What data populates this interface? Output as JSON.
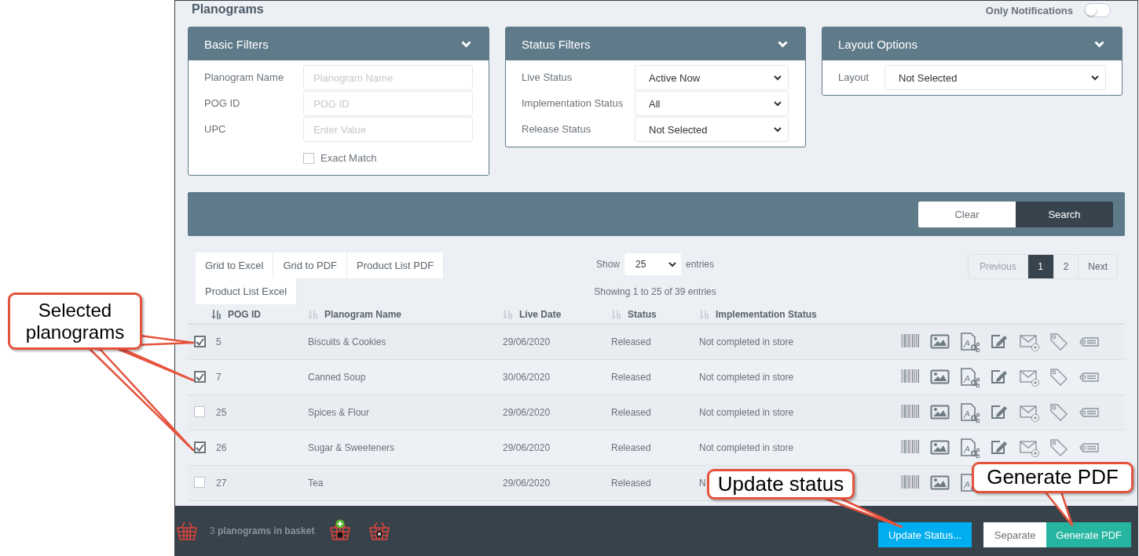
{
  "page": {
    "title": "Planograms",
    "only_notifications": {
      "label": "Only Notifications",
      "on": false
    }
  },
  "filter_panels": [
    {
      "title": "Basic Filters",
      "fields": [
        {
          "kind": "text",
          "label": "Planogram Name",
          "placeholder": "Planogram Name"
        },
        {
          "kind": "text",
          "label": "POG ID",
          "placeholder": "POG ID"
        },
        {
          "kind": "text",
          "label": "UPC",
          "placeholder": "Enter Value"
        }
      ],
      "exact_match": {
        "label": "Exact Match",
        "checked": false
      }
    },
    {
      "title": "Status Filters",
      "fields": [
        {
          "kind": "select",
          "label": "Live Status",
          "value": "Active Now"
        },
        {
          "kind": "select",
          "label": "Implementation Status",
          "value": "All"
        },
        {
          "kind": "select",
          "label": "Release Status",
          "value": "Not Selected"
        }
      ]
    },
    {
      "title": "Layout Options",
      "fields": [
        {
          "kind": "select",
          "label": "Layout",
          "value": "Not Selected"
        }
      ]
    }
  ],
  "search_bar": {
    "buttons": [
      {
        "kind": "secondary",
        "label": "Clear"
      },
      {
        "kind": "primary",
        "label": "Search"
      }
    ]
  },
  "exports": [
    "Grid to Excel",
    "Grid to PDF",
    "Product List PDF",
    "Product List Excel"
  ],
  "page_size": {
    "show_label": "Show",
    "value": "25",
    "entries_label": "entries"
  },
  "info": "Showing 1 to 25 of 39 entries",
  "pagination": [
    {
      "label": "Previous",
      "selected": false,
      "disabled": true
    },
    {
      "label": "1",
      "selected": true,
      "disabled": false
    },
    {
      "label": "2",
      "selected": false,
      "disabled": false
    },
    {
      "label": "Next",
      "selected": false,
      "disabled": false
    }
  ],
  "table": {
    "columns": [
      {
        "label": "POG ID",
        "sorted": true
      },
      {
        "label": "Planogram Name",
        "sorted": false
      },
      {
        "label": "Live Date",
        "sorted": false
      },
      {
        "label": "Status",
        "sorted": false
      },
      {
        "label": "Implementation Status",
        "sorted": false
      }
    ],
    "rows": [
      {
        "checked": true,
        "pog_id": "5",
        "name": "Biscuits & Cookies",
        "live_date": "29/06/2020",
        "status": "Released",
        "implementation": "Not completed in store"
      },
      {
        "checked": true,
        "pog_id": "7",
        "name": "Canned Soup",
        "live_date": "30/06/2020",
        "status": "Released",
        "implementation": "Not completed in store"
      },
      {
        "checked": false,
        "pog_id": "25",
        "name": "Spices & Flour",
        "live_date": "29/06/2020",
        "status": "Released",
        "implementation": "Not completed in store"
      },
      {
        "checked": true,
        "pog_id": "26",
        "name": "Sugar & Sweeteners",
        "live_date": "29/06/2020",
        "status": "Released",
        "implementation": "Not completed in store"
      },
      {
        "checked": false,
        "pog_id": "27",
        "name": "Tea",
        "live_date": "29/06/2020",
        "status": "Released",
        "implementation": "N"
      }
    ]
  },
  "footer": {
    "basket_text": "3 **planograms in basket**",
    "buttons": [
      {
        "kind": "info",
        "label": "Update Status..."
      },
      {
        "kind": "plain",
        "label": "Separate"
      },
      {
        "kind": "success",
        "label": "Generate PDF"
      }
    ]
  },
  "callouts": [
    {
      "text": "Selected planograms"
    },
    {
      "text": "Update status"
    },
    {
      "text": "Generate PDF"
    }
  ]
}
